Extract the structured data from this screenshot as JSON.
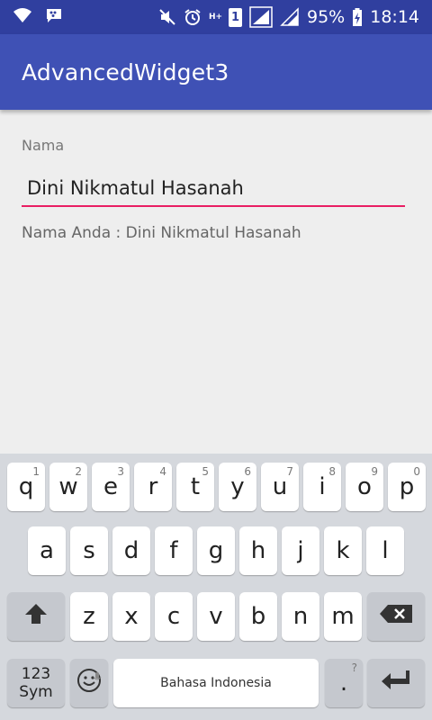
{
  "status_bar": {
    "signal_type": "H+",
    "sim_slot": "1",
    "battery": "95%",
    "time": "18:14",
    "icons": [
      "wifi-icon",
      "bbm-icon",
      "mute-icon",
      "alarm-icon",
      "signal-icon",
      "signal-icon-2",
      "battery-charging-icon"
    ]
  },
  "app_bar": {
    "title": "AdvancedWidget3"
  },
  "form": {
    "label": "Nama",
    "value": "Dini Nikmatul Hasanah",
    "result": "Nama Anda : Dini Nikmatul Hasanah",
    "accent_color": "#e91e63"
  },
  "keyboard": {
    "row1": [
      "q",
      "w",
      "e",
      "r",
      "t",
      "y",
      "u",
      "i",
      "o",
      "p"
    ],
    "row1_hints": [
      "1",
      "2",
      "3",
      "4",
      "5",
      "6",
      "7",
      "8",
      "9",
      "0"
    ],
    "row2": [
      "a",
      "s",
      "d",
      "f",
      "g",
      "h",
      "j",
      "k",
      "l"
    ],
    "row3": [
      "z",
      "x",
      "c",
      "v",
      "b",
      "n",
      "m"
    ],
    "sym_label_top": "123",
    "sym_label_bottom": "Sym",
    "space_label": "Bahasa Indonesia",
    "period": ".",
    "period_hint": "?"
  },
  "colors": {
    "primary": "#3f51b5",
    "primary_dark": "#303f9f"
  }
}
